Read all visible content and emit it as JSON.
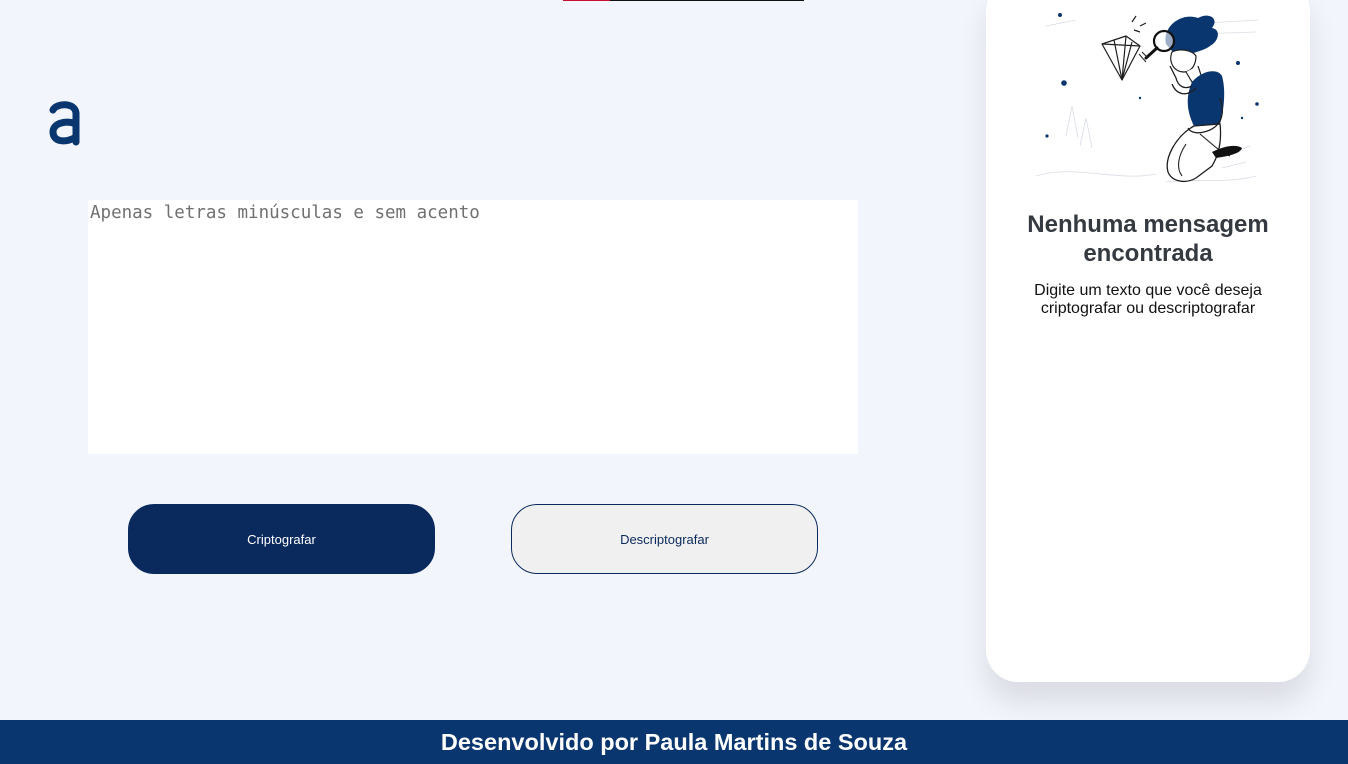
{
  "header": {
    "logo_icon": "alura-a-logo-icon"
  },
  "input": {
    "placeholder": "Apenas letras minúsculas e sem acento",
    "value": ""
  },
  "buttons": {
    "encrypt_label": "Criptografar",
    "decrypt_label": "Descriptografar"
  },
  "output": {
    "illustration_icon": "person-with-magnifying-glass-illustration",
    "title": "Nenhuma mensagem encontrada",
    "text": "Digite um texto que você deseja criptografar ou descriptografar"
  },
  "footer": {
    "text": "Desenvolvido por Paula Martins de Souza"
  },
  "colors": {
    "page_background": "#f3f5fc",
    "primary": "#0a2a5e",
    "footer": "#0a3670",
    "secondary_button": "#f0f0f0",
    "accent": "#c8102e"
  }
}
